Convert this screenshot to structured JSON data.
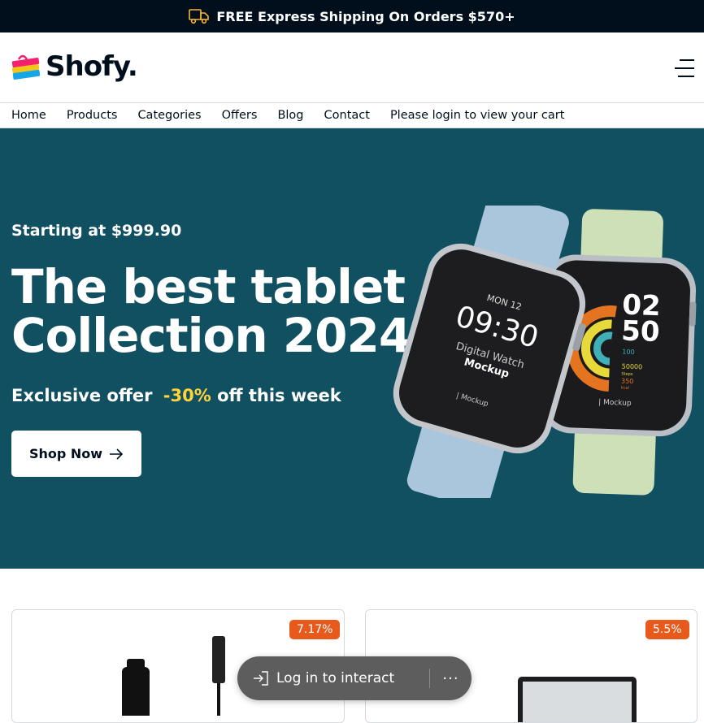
{
  "topbar": {
    "text": "FREE Express Shipping On Orders $570+",
    "icon": "truck-icon"
  },
  "header": {
    "logo_text": "Shofy.",
    "menu_icon": "hamburger-icon"
  },
  "nav": {
    "items": [
      "Home",
      "Products",
      "Categories",
      "Offers",
      "Blog",
      "Contact",
      "Please login to view your cart"
    ]
  },
  "hero": {
    "price_text": "Starting at $999.90",
    "title_line1": "The best tablet",
    "title_line2": "Collection 2024",
    "offer_prefix": "Exclusive offer",
    "offer_pct": "-30%",
    "offer_suffix": "off this week",
    "button_label": "Shop Now",
    "bg_color": "#115061",
    "accent_color": "#ffd43b",
    "watch1": {
      "date": "MON 12",
      "time": "09:30",
      "line1": "Digital Watch",
      "line2": "Mockup",
      "brand": "| Mockup"
    },
    "watch2": {
      "hour": "02",
      "minute": "50",
      "stat1": "100",
      "stat2": "50000",
      "stat2_label": "Steps",
      "stat3": "350",
      "stat3_label": "kcal",
      "brand": "| Mockup"
    }
  },
  "products": [
    {
      "badge": "7.17%"
    },
    {
      "badge": "5.5%"
    }
  ],
  "toast": {
    "login_label": "Log in to interact",
    "more_label": "···"
  },
  "colors": {
    "dark": "#010f1c",
    "badge": "#e85a1b"
  }
}
